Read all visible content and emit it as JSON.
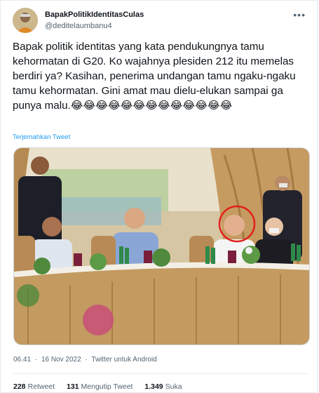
{
  "author": {
    "display_name": "BapakPolitikIdentitasCulas",
    "handle": "@deditelaumbanu4"
  },
  "more_icon": "more-horizontal-icon",
  "tweet_text": "Bapak politik identitas yang kata pendukungnya tamu kehormatan di G20. Ko wajahnya plesiden 212 itu memelas berdiri ya? Kasihan, penerima undangan tamu ngaku-ngaku tamu kehormatan. Gini amat mau dielu-elukan sampai ga punya malu.😂😂😂😂😂😂😂😂😂😂😂😂😂",
  "translate_link": "Terjemahkan Tweet",
  "timestamp": {
    "time": "06.41",
    "date": "16 Nov 2022",
    "separator": "·",
    "source": "Twitter untuk Android"
  },
  "stats": [
    {
      "count": "228",
      "label": "Retweet"
    },
    {
      "count": "131",
      "label": "Mengutip Tweet"
    },
    {
      "count": "1.349",
      "label": "Suka"
    }
  ],
  "colors": {
    "link": "#1d9bf0",
    "muted": "#536471",
    "highlight_circle": "#e0201b"
  }
}
